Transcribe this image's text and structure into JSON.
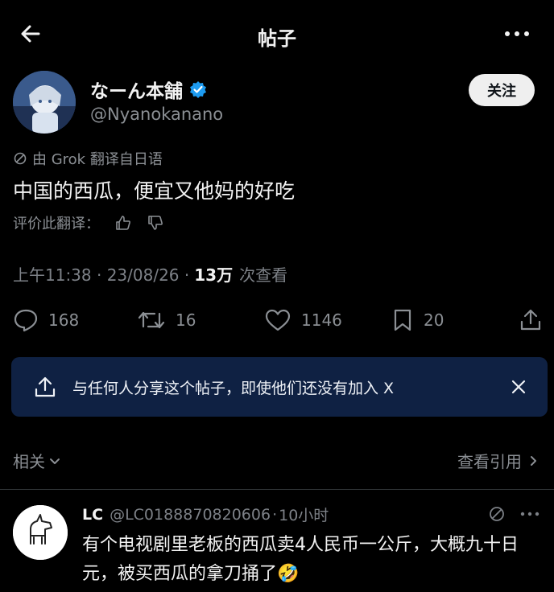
{
  "topbar": {
    "title": "帖子"
  },
  "author": {
    "display_name": "なーん本舗",
    "handle": "@Nyanokanano",
    "follow_label": "关注"
  },
  "tweet": {
    "translated_by": "由 Grok 翻译自日语",
    "text": "中国的西瓜，便宜又他妈的好吃",
    "rate_label": "评价此翻译：",
    "time": "上午11:38 · 23/08/26 · ",
    "views_count": "13万",
    "views_label": "次查看"
  },
  "actions": {
    "replies": "168",
    "retweets": "16",
    "likes": "1146",
    "bookmarks": "20"
  },
  "share_banner": {
    "text": "与任何人分享这个帖子，即使他们还没有加入 X"
  },
  "related": {
    "label": "相关",
    "quotes_link": "查看引用"
  },
  "reply": {
    "name": "LC",
    "handle": "@LC0188870820606",
    "sep": "·",
    "time": "10小时",
    "text": "有个电视剧里老板的西瓜卖4人民币一公斤，大概九十日元，被买西瓜的拿刀捅了🤣"
  },
  "colors": {
    "background": "#000000",
    "text_primary": "#f2f2f2",
    "text_secondary": "#8b8f94",
    "verified_blue": "#1d9bf0",
    "banner_bg": "#0f2143"
  }
}
